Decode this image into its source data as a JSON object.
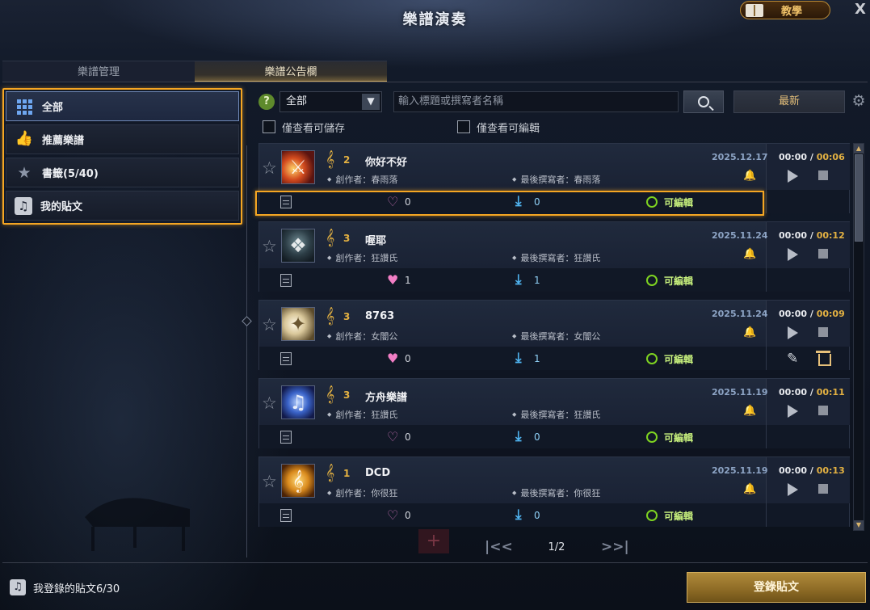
{
  "window": {
    "title": "樂譜演奏",
    "tutorial_label": "教學",
    "close_label": "X"
  },
  "tabs": [
    {
      "label": "樂譜管理",
      "active": false
    },
    {
      "label": "樂譜公告欄",
      "active": true
    }
  ],
  "sidebar": {
    "items": [
      {
        "label": "全部",
        "icon": "grid-icon",
        "active": true
      },
      {
        "label": "推薦樂譜",
        "icon": "thumbs-up-icon",
        "active": false
      },
      {
        "label": "書籤(5/40)",
        "icon": "star-icon",
        "active": false
      },
      {
        "label": "我的貼文",
        "icon": "music-note-icon",
        "active": false
      }
    ]
  },
  "toolbar": {
    "help": "?",
    "filter_value": "全部",
    "search_placeholder": "輸入標題或撰寫者名稱",
    "sort_label": "最新",
    "gear": "⚙"
  },
  "filters": {
    "only_saveable": "僅查看可儲存",
    "only_editable": "僅查看可編輯"
  },
  "songs": [
    {
      "level": "2",
      "title": "你好不好",
      "composer": "創作者：春雨落",
      "last_editor": "最後撰寫者：春雨落",
      "date": "2025.12.17",
      "time_pos": "00:00",
      "sep": " / ",
      "duration": "00:06",
      "likes": "0",
      "liked": false,
      "downloads": "0",
      "editable_label": "可編輯",
      "own_post": false
    },
    {
      "level": "3",
      "title": "喔耶",
      "composer": "創作者：狂讚氏",
      "last_editor": "最後撰寫者：狂讚氏",
      "date": "2025.11.24",
      "time_pos": "00:00",
      "sep": " / ",
      "duration": "00:12",
      "likes": "1",
      "liked": true,
      "downloads": "1",
      "editable_label": "可編輯",
      "own_post": false
    },
    {
      "level": "3",
      "title": "8763",
      "composer": "創作者：女闇公",
      "last_editor": "最後撰寫者：女闇公",
      "date": "2025.11.24",
      "time_pos": "00:00",
      "sep": " / ",
      "duration": "00:09",
      "likes": "0",
      "liked": true,
      "downloads": "1",
      "editable_label": "可編輯",
      "own_post": true
    },
    {
      "level": "3",
      "title": "方舟樂譜",
      "composer": "創作者：狂讚氏",
      "last_editor": "最後撰寫者：狂讚氏",
      "date": "2025.11.19",
      "time_pos": "00:00",
      "sep": " / ",
      "duration": "00:11",
      "likes": "0",
      "liked": false,
      "downloads": "0",
      "editable_label": "可編輯",
      "own_post": false
    },
    {
      "level": "1",
      "title": "DCD",
      "composer": "創作者：你很狂",
      "last_editor": "最後撰寫者：你很狂",
      "date": "2025.11.19",
      "time_pos": "00:00",
      "sep": " / ",
      "duration": "00:13",
      "likes": "0",
      "liked": false,
      "downloads": "0",
      "editable_label": "可編輯",
      "own_post": false
    }
  ],
  "pagination": {
    "text": "1/2",
    "first": "|<<",
    "last": ">>|"
  },
  "footer": {
    "my_posts_label": "我登錄的貼文6/30",
    "register_label": "登錄貼文"
  },
  "colors": {
    "highlight": "#f5a623",
    "accent_gold": "#e3b142",
    "editable_green": "#7ed321",
    "download_blue": "#4fb2ee",
    "like_pink": "#f27ec5"
  }
}
